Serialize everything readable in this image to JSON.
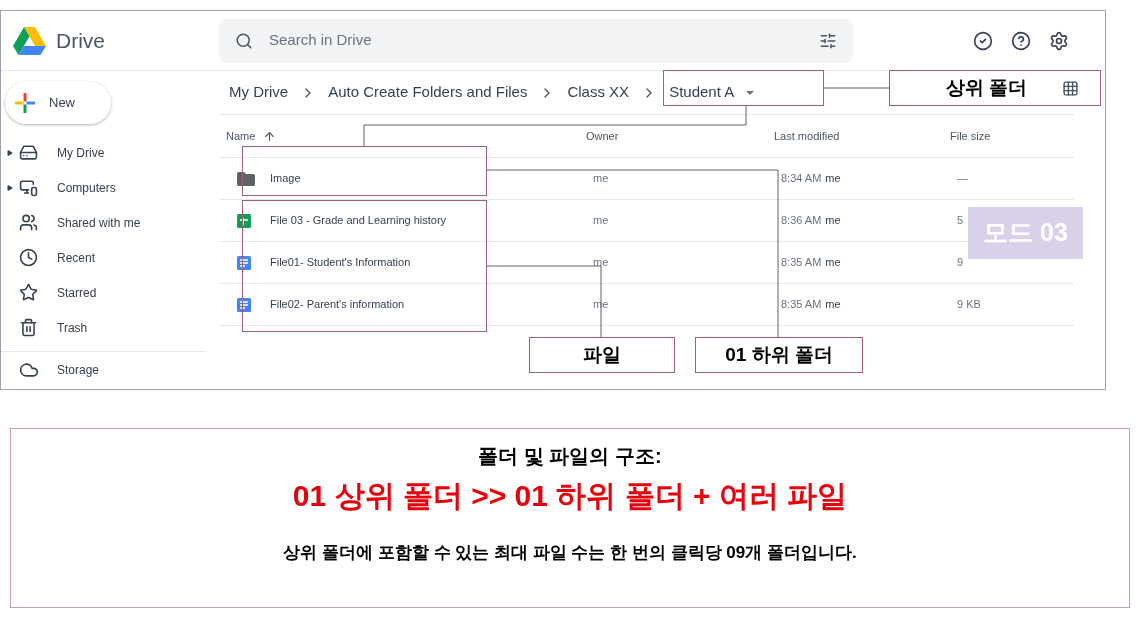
{
  "drive": {
    "app_name": "Drive",
    "search": {
      "placeholder": "Search in Drive"
    },
    "new_button": "New",
    "sidebar": {
      "items": [
        {
          "kind": "my-drive",
          "label": "My Drive",
          "expandable": true
        },
        {
          "kind": "computers",
          "label": "Computers",
          "expandable": true
        },
        {
          "kind": "shared",
          "label": "Shared with me",
          "expandable": false
        },
        {
          "kind": "recent",
          "label": "Recent",
          "expandable": false
        },
        {
          "kind": "starred",
          "label": "Starred",
          "expandable": false
        },
        {
          "kind": "trash",
          "label": "Trash",
          "expandable": false
        }
      ],
      "storage": "Storage"
    },
    "breadcrumbs": [
      "My Drive",
      "Auto Create Folders and Files",
      "Class XX",
      "Student A"
    ],
    "table": {
      "columns": [
        "Name",
        "Owner",
        "Last modified",
        "File size"
      ],
      "rows": [
        {
          "kind": "folder",
          "name": "Image",
          "owner": "me",
          "modified": "8:34 AM",
          "modified_by": "me",
          "size": "—"
        },
        {
          "kind": "sheet",
          "name": "File 03 - Grade and Learning history",
          "owner": "me",
          "modified": "8:36 AM",
          "modified_by": "me",
          "size": "5"
        },
        {
          "kind": "doc",
          "name": "File01- Student's Information",
          "owner": "me",
          "modified": "8:35 AM",
          "modified_by": "me",
          "size": "9"
        },
        {
          "kind": "doc",
          "name": "File02- Parent's information",
          "owner": "me",
          "modified": "8:35 AM",
          "modified_by": "me",
          "size": "9 KB"
        }
      ]
    }
  },
  "annotations": {
    "parent_folder": "상위 폴더",
    "files": "파일",
    "subfolder": "01 하위 폴더",
    "mode_badge": "모드 03"
  },
  "caption": {
    "heading": "폴더 및 파일의 구조:",
    "structure": "01 상위 폴더 >> 01 하위 폴더 + 여러 파일",
    "note": "상위 폴더에 포함할 수 있는 최대 파일 수는 한 번의 클릭당 09개 폴더입니다."
  }
}
